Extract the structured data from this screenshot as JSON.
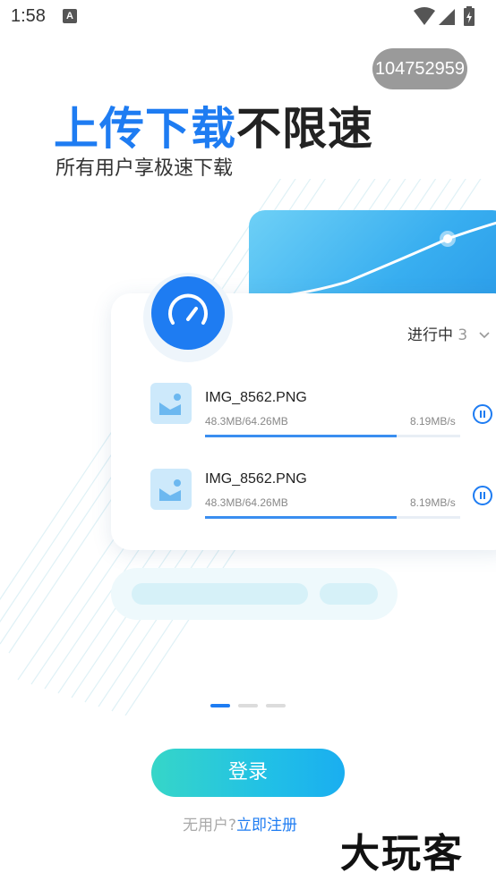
{
  "status_bar": {
    "time": "1:58",
    "notification_icon_letter": "A",
    "icons": [
      "wifi-icon",
      "signal-icon",
      "battery-charging-icon"
    ]
  },
  "user_id_badge": "104752959",
  "headline": {
    "blue_text": "上传下载",
    "dark_text": "不限速"
  },
  "subheadline": "所有用户享极速下载",
  "illustration": {
    "status_filter": {
      "label": "进行中",
      "count": "3"
    },
    "downloads": [
      {
        "file_name": "IMG_8562.PNG",
        "size_progress": "48.3MB/64.26MB",
        "speed": "8.19MB/s",
        "progress": 0.75
      },
      {
        "file_name": "IMG_8562.PNG",
        "size_progress": "48.3MB/64.26MB",
        "speed": "8.19MB/s",
        "progress": 0.75
      }
    ]
  },
  "pager": {
    "count": 3,
    "active_index": 0
  },
  "login_button_label": "登录",
  "register": {
    "prompt": "无用户?",
    "link": "立即注册"
  },
  "watermark": "大玩客",
  "colors": {
    "accent_blue": "#1e7cf2",
    "login_gradient_start": "#36d6c8",
    "login_gradient_end": "#1aaef0"
  }
}
